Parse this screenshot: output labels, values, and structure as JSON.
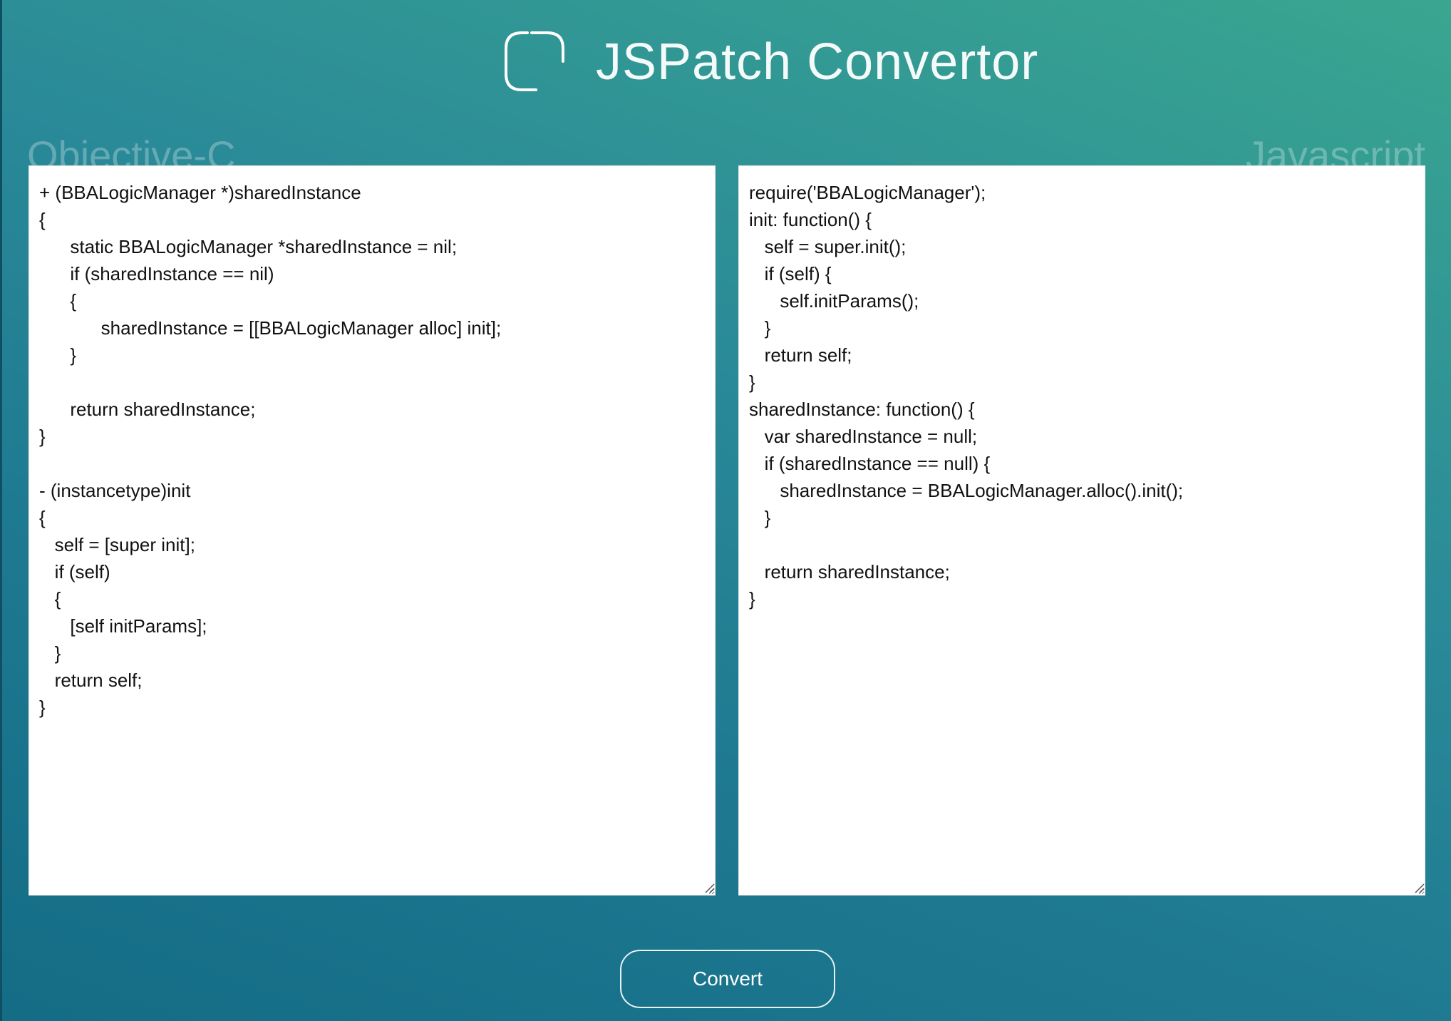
{
  "header": {
    "title": "JSPatch Convertor",
    "logo_icon": "rounded-square-outline-icon"
  },
  "left_pane": {
    "label": "Objective-C",
    "code": "+ (BBALogicManager *)sharedInstance\n{\n      static BBALogicManager *sharedInstance = nil;\n      if (sharedInstance == nil)\n      {\n            sharedInstance = [[BBALogicManager alloc] init];\n      }\n\n      return sharedInstance;\n}\n\n- (instancetype)init\n{\n   self = [super init];\n   if (self)\n   {\n      [self initParams];\n   }\n   return self;\n}"
  },
  "right_pane": {
    "label": "Javascript",
    "code": "require('BBALogicManager');\ninit: function() {\n   self = super.init();\n   if (self) {\n      self.initParams();\n   }\n   return self;\n}\nsharedInstance: function() {\n   var sharedInstance = null;\n   if (sharedInstance == null) {\n      sharedInstance = BBALogicManager.alloc().init();\n   }\n\n   return sharedInstance;\n}"
  },
  "actions": {
    "convert_label": "Convert"
  },
  "colors": {
    "gradient_dark": "#146c85",
    "gradient_light": "#3aa690",
    "editor_bg": "#ffffff",
    "text": "#111111"
  }
}
